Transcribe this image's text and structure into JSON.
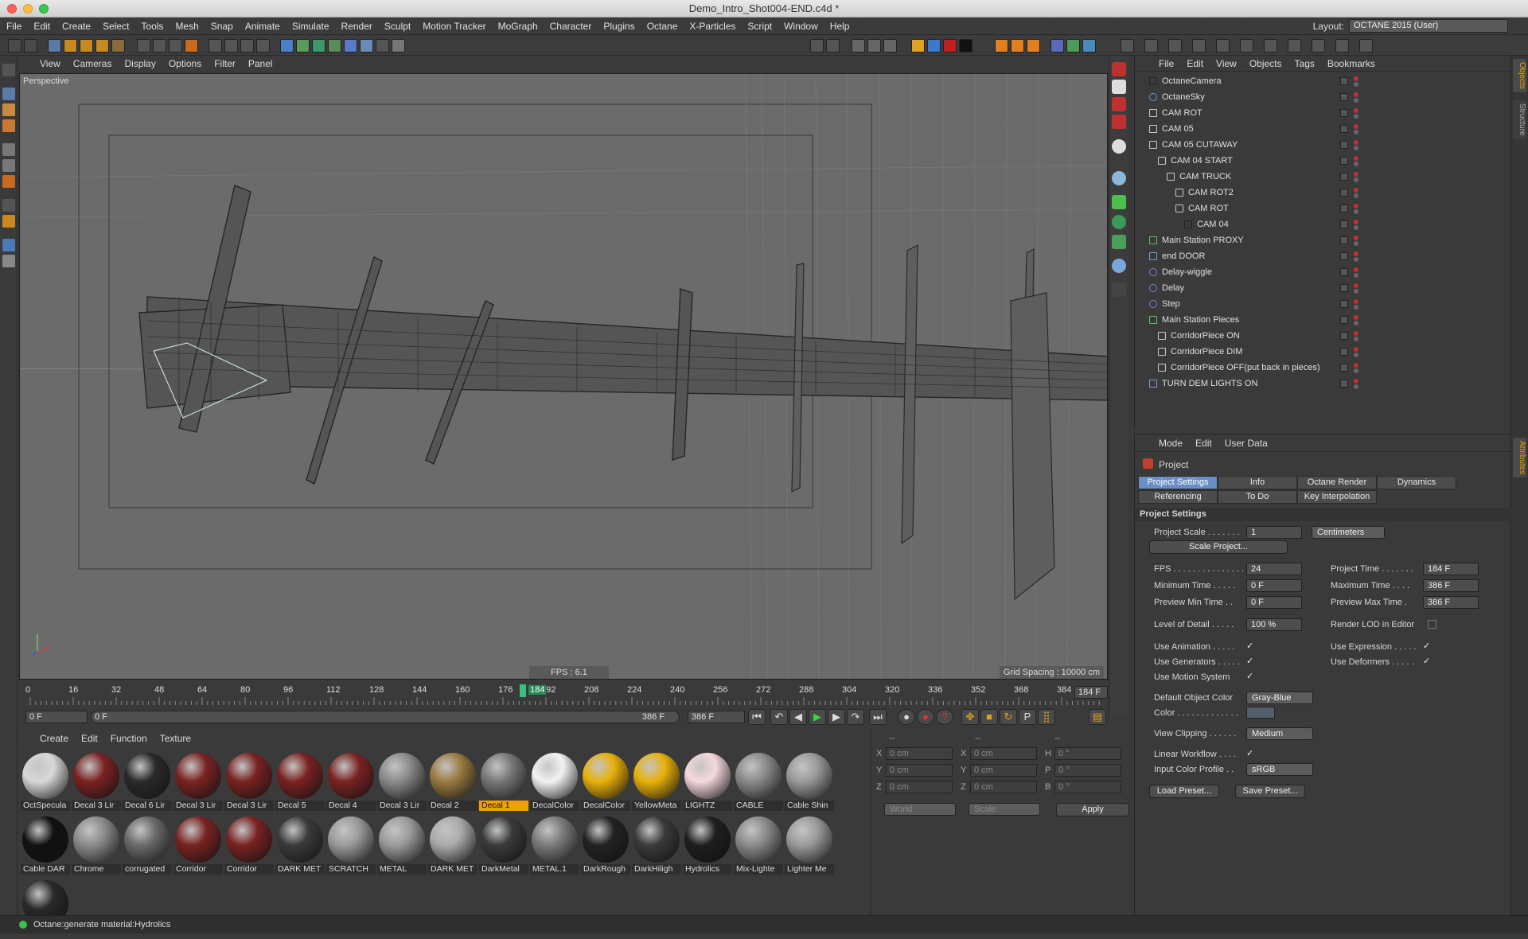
{
  "window": {
    "title": "Demo_Intro_Shot004-END.c4d *"
  },
  "menubar": {
    "items": [
      "File",
      "Edit",
      "Create",
      "Select",
      "Tools",
      "Mesh",
      "Snap",
      "Animate",
      "Simulate",
      "Render",
      "Sculpt",
      "Motion Tracker",
      "MoGraph",
      "Character",
      "Plugins",
      "Octane",
      "X-Particles",
      "Script",
      "Window",
      "Help"
    ],
    "layout_label": "Layout:",
    "layout_value": "OCTANE 2015 (User)"
  },
  "viewport": {
    "menu": [
      "View",
      "Cameras",
      "Display",
      "Options",
      "Filter",
      "Panel"
    ],
    "label": "Perspective",
    "fps": "FPS : 6.1",
    "grid_spacing": "Grid Spacing : 10000 cm"
  },
  "timeline": {
    "ticks": [
      "0",
      "16",
      "32",
      "48",
      "64",
      "80",
      "96",
      "112",
      "128",
      "144",
      "160",
      "176",
      "192",
      "208",
      "224",
      "240",
      "256",
      "272",
      "288",
      "304",
      "320",
      "336",
      "352",
      "368",
      "384"
    ],
    "playhead_label": "184",
    "current_frame": "184 F",
    "start_field": "0 F",
    "range_start": "0 F",
    "range_end": "386 F",
    "end_field": "386 F"
  },
  "materials": {
    "menu": [
      "Create",
      "Edit",
      "Function",
      "Texture"
    ],
    "items": [
      {
        "label": "OctSpecula",
        "color": "#d8d8d8",
        "selected": false
      },
      {
        "label": "Decal 3 Lir",
        "color": "#7a2222",
        "selected": false
      },
      {
        "label": "Decal 6 Lir",
        "color": "#2a2a2a",
        "selected": false
      },
      {
        "label": "Decal 3 Lir",
        "color": "#7a2222",
        "selected": false
      },
      {
        "label": "Decal 3 Lir",
        "color": "#7a2222",
        "selected": false
      },
      {
        "label": "Decal 5",
        "color": "#7a2222",
        "selected": false
      },
      {
        "label": "Decal 4",
        "color": "#7a2222",
        "selected": false
      },
      {
        "label": "Decal 3 Lir",
        "color": "#8a8a8a",
        "selected": false
      },
      {
        "label": "Decal 2",
        "color": "#9a7a40",
        "selected": false
      },
      {
        "label": "Decal 1",
        "color": "#777777",
        "selected": true
      },
      {
        "label": "DecalColor",
        "color": "#f2f2f2",
        "selected": false
      },
      {
        "label": "DecalColor",
        "color": "#e8b10a",
        "selected": false
      },
      {
        "label": "YellowMeta",
        "color": "#e8b10a",
        "selected": false
      },
      {
        "label": "LIGHTZ",
        "color": "#f4d8dc",
        "selected": false
      },
      {
        "label": "CABLE",
        "color": "#8a8a8a",
        "selected": false
      },
      {
        "label": "Cable Shin",
        "color": "#9a9a9a",
        "selected": false
      },
      {
        "label": "Cable DAR",
        "color": "#111111",
        "selected": false
      },
      {
        "label": "Chrome",
        "color": "#8a8a8a",
        "selected": false
      },
      {
        "label": "corrugated",
        "color": "#6a6a6a",
        "selected": false
      },
      {
        "label": "Corridor",
        "color": "#7a2222",
        "selected": false
      },
      {
        "label": "Corridor",
        "color": "#7a2222",
        "selected": false
      },
      {
        "label": "DARK MET",
        "color": "#3a3a3a",
        "selected": false
      },
      {
        "label": "SCRATCH",
        "color": "#9a9a9a",
        "selected": false
      },
      {
        "label": "METAL",
        "color": "#9a9a9a",
        "selected": false
      },
      {
        "label": "DARK MET",
        "color": "#aaaaaa",
        "selected": false
      },
      {
        "label": "DarkMetal",
        "color": "#3a3a3a",
        "selected": false
      },
      {
        "label": "METAL.1",
        "color": "#7a7a7a",
        "selected": false
      },
      {
        "label": "DarkRough",
        "color": "#222222",
        "selected": false
      },
      {
        "label": "DarkHiligh",
        "color": "#3a3a3a",
        "selected": false
      },
      {
        "label": "Hydrolics",
        "color": "#1e1e1e",
        "selected": false
      },
      {
        "label": "Mix-Lighte",
        "color": "#8a8a8a",
        "selected": false
      },
      {
        "label": "Lighter Me",
        "color": "#9a9a9a",
        "selected": false
      },
      {
        "label": "",
        "color": "#2a2a2a",
        "selected": false
      }
    ]
  },
  "coords": {
    "header": [
      "--",
      "--",
      "--"
    ],
    "rows": [
      {
        "a": "X",
        "av": "0 cm",
        "b": "X",
        "bv": "0 cm",
        "c": "H",
        "cv": "0 °"
      },
      {
        "a": "Y",
        "av": "0 cm",
        "b": "Y",
        "bv": "0 cm",
        "c": "P",
        "cv": "0 °"
      },
      {
        "a": "Z",
        "av": "0 cm",
        "b": "Z",
        "bv": "0 cm",
        "c": "B",
        "cv": "0 °"
      }
    ],
    "world": "World",
    "scale": "Scale",
    "apply": "Apply"
  },
  "objects": {
    "menu": [
      "File",
      "Edit",
      "View",
      "Objects",
      "Tags",
      "Bookmarks"
    ],
    "items": [
      {
        "name": "OctaneCamera",
        "indent": 0,
        "icon": "camera"
      },
      {
        "name": "OctaneSky",
        "indent": 0,
        "icon": "sky"
      },
      {
        "name": "CAM ROT",
        "indent": 0,
        "icon": "null"
      },
      {
        "name": "CAM 05",
        "indent": 0,
        "icon": "null"
      },
      {
        "name": "CAM 05 CUTAWAY",
        "indent": 0,
        "icon": "null"
      },
      {
        "name": "CAM 04 START",
        "indent": 1,
        "icon": "null"
      },
      {
        "name": "CAM TRUCK",
        "indent": 2,
        "icon": "null"
      },
      {
        "name": "CAM ROT2",
        "indent": 3,
        "icon": "null"
      },
      {
        "name": "CAM ROT",
        "indent": 3,
        "icon": "null"
      },
      {
        "name": "CAM 04",
        "indent": 4,
        "icon": "camera"
      },
      {
        "name": "Main Station PROXY",
        "indent": 0,
        "icon": "generator"
      },
      {
        "name": "end DOOR",
        "indent": 0,
        "icon": "mesh"
      },
      {
        "name": "Delay-wiggle",
        "indent": 0,
        "icon": "effector"
      },
      {
        "name": "Delay",
        "indent": 0,
        "icon": "effector"
      },
      {
        "name": "Step",
        "indent": 0,
        "icon": "effector"
      },
      {
        "name": "Main Station Pieces",
        "indent": 0,
        "icon": "generator"
      },
      {
        "name": "CorridorPiece ON",
        "indent": 1,
        "icon": "null"
      },
      {
        "name": "CorridorPiece DIM",
        "indent": 1,
        "icon": "null"
      },
      {
        "name": "CorridorPiece OFF(put back in pieces)",
        "indent": 1,
        "icon": "null"
      },
      {
        "name": "TURN DEM LIGHTS ON",
        "indent": 0,
        "icon": "mesh"
      }
    ]
  },
  "side_tabs": {
    "objects": "Objects",
    "structure": "Structure",
    "attributes": "Attributes"
  },
  "attributes": {
    "menu": [
      "Mode",
      "Edit",
      "User Data"
    ],
    "object": "Project",
    "tabs_row1": [
      "Project Settings",
      "Info",
      "Octane Render",
      "Dynamics"
    ],
    "tabs_row2": [
      "Referencing",
      "To Do",
      "Key Interpolation"
    ],
    "section": "Project Settings",
    "project_scale_label": "Project Scale . . . . . . .",
    "project_scale": "1",
    "scale_unit": "Centimeters",
    "scale_project_btn": "Scale Project...",
    "fps_label": "FPS . . . . . . . . . . . . . . . .",
    "fps": "24",
    "project_time_label": "Project Time . . . . . . .",
    "project_time": "184 F",
    "min_time_label": "Minimum Time . . . . .",
    "min_time": "0 F",
    "max_time_label": "Maximum Time . . . .",
    "max_time": "386 F",
    "prev_min_label": "Preview Min Time . .",
    "prev_min": "0 F",
    "prev_max_label": "Preview Max Time .",
    "prev_max": "386 F",
    "lod_label": "Level of Detail . . . . .",
    "lod": "100 %",
    "render_lod_label": "Render LOD in Editor",
    "use_anim_label": "Use Animation . . . . .",
    "use_expr_label": "Use Expression . . . . .",
    "use_gen_label": "Use Generators . . . . .",
    "use_def_label": "Use Deformers . . . . .",
    "use_motion_label": "Use Motion System",
    "def_color_label": "Default Object Color",
    "def_color": "Gray-Blue",
    "color_label": "Color . . . . . . . . . . . . .",
    "clipping_label": "View Clipping . . . . . .",
    "clipping": "Medium",
    "linear_label": "Linear Workflow . . . .",
    "input_profile_label": "Input Color Profile . .",
    "input_profile": "sRGB",
    "load_preset": "Load Preset...",
    "save_preset": "Save Preset..."
  },
  "status": {
    "text": "Octane:generate material:Hydrolics"
  }
}
